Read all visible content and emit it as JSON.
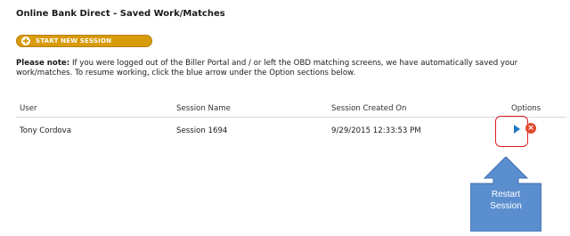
{
  "page": {
    "title": "Online Bank Direct - Saved Work/Matches"
  },
  "start_button": {
    "label": "START NEW SESSION",
    "icon": "plus-circle-icon"
  },
  "note": {
    "label": "Please note:",
    "text": "If you were logged out of the Biller Portal and / or left the OBD matching screens, we have automatically saved your work/matches. To resume working, click the blue arrow under the Option sections below."
  },
  "table": {
    "headers": {
      "user": "User",
      "session_name": "Session Name",
      "created_on": "Session Created On",
      "options": "Options"
    },
    "rows": [
      {
        "user": "Tony Cordova",
        "session_name": "Session 1694",
        "created_on": "9/29/2015 12:33:53 PM",
        "resume_icon": "play-arrow-icon",
        "delete_icon": "delete-x-icon"
      }
    ]
  },
  "callout": {
    "line1": "Restart",
    "line2": "Session"
  },
  "colors": {
    "button": "#d89b0b",
    "highlight": "#e02020",
    "callout_fill": "#5b8ecf",
    "play": "#1f78c1",
    "delete": "#e04a2f"
  }
}
